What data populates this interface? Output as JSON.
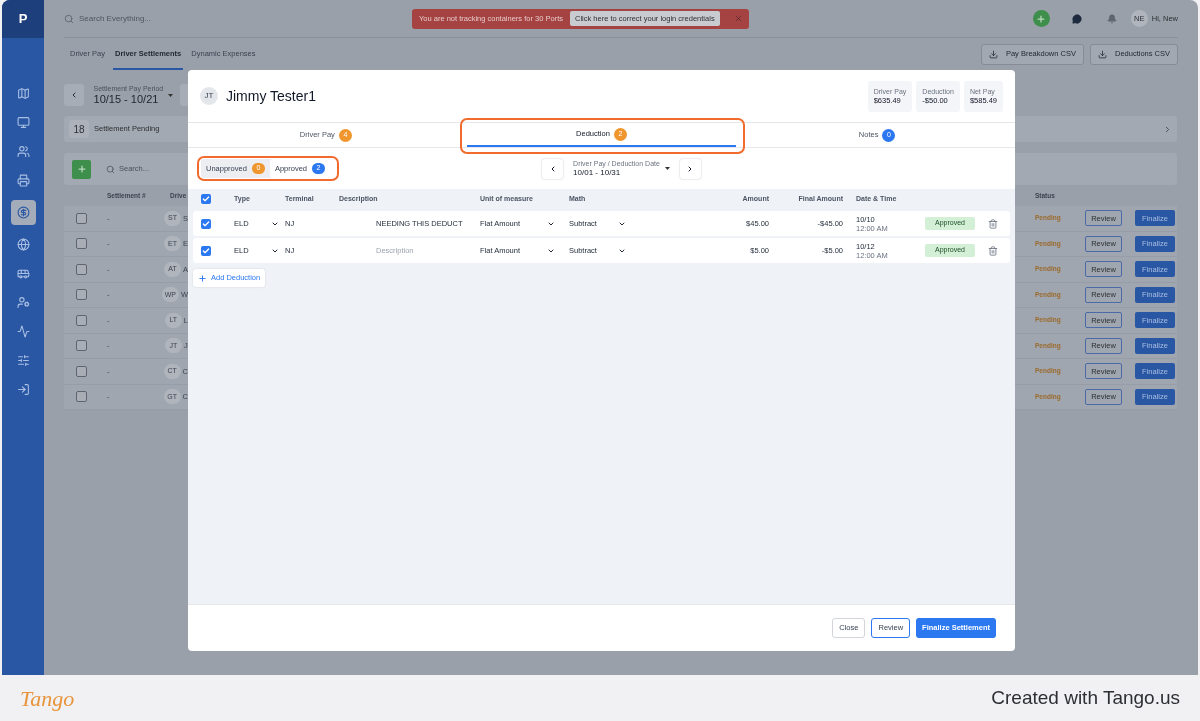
{
  "logo": "P",
  "sidebar": {
    "items": [
      {
        "selected": false
      },
      {
        "selected": false
      },
      {
        "selected": false
      },
      {
        "selected": false
      },
      {
        "selected": true
      },
      {
        "selected": false
      },
      {
        "selected": false
      },
      {
        "selected": false
      },
      {
        "selected": false
      },
      {
        "selected": false
      },
      {
        "selected": false
      }
    ]
  },
  "topbar": {
    "search_placeholder": "Search Everything...",
    "banner": {
      "message": "You are not tracking containers for 30 Ports",
      "action": "Click here to correct your login credentials"
    },
    "user_initials": "NE",
    "greeting": "Hi, New"
  },
  "page_tabs": [
    {
      "label": "Driver Pay",
      "selected": false
    },
    {
      "label": "Driver Settlements",
      "selected": true
    },
    {
      "label": "Dynamic Expenses",
      "selected": false
    }
  ],
  "export_buttons": [
    "Pay Breakdown CSV",
    "Deductions CSV"
  ],
  "period": {
    "label": "Settlement Pay Period",
    "value": "10/15 - 10/21"
  },
  "pending": {
    "count": "18",
    "label": "Settlement Pending"
  },
  "list_search_placeholder": "Search...",
  "background_table": {
    "columns": [
      "Settlement #",
      "Drive"
    ],
    "status_column": "Status",
    "rows": [
      {
        "checked": false,
        "settlement": "-",
        "initials": "ST",
        "name": "S",
        "status": "Pending",
        "review": "Review",
        "finalize": "Finalize"
      },
      {
        "checked": false,
        "settlement": "-",
        "initials": "ET",
        "name": "E",
        "status": "Pending",
        "review": "Review",
        "finalize": "Finalize"
      },
      {
        "checked": false,
        "settlement": "-",
        "initials": "AT",
        "name": "A",
        "status": "Pending",
        "review": "Review",
        "finalize": "Finalize"
      },
      {
        "checked": false,
        "settlement": "-",
        "initials": "WP",
        "name": "W",
        "status": "Pending",
        "review": "Review",
        "finalize": "Finalize"
      },
      {
        "checked": false,
        "settlement": "-",
        "initials": "LT",
        "name": "L",
        "status": "Pending",
        "review": "Review",
        "finalize": "Finalize"
      },
      {
        "checked": false,
        "settlement": "-",
        "initials": "JT",
        "name": "J",
        "status": "Pending",
        "review": "Review",
        "finalize": "Finalize"
      },
      {
        "checked": false,
        "settlement": "-",
        "initials": "CT",
        "name": "C",
        "status": "Pending",
        "review": "Review",
        "finalize": "Finalize"
      },
      {
        "checked": false,
        "settlement": "-",
        "initials": "GT",
        "name": "C",
        "status": "Pending",
        "review": "Review",
        "finalize": "Finalize"
      }
    ]
  },
  "modal": {
    "initials": "JT",
    "driver": "Jimmy Tester1",
    "stats": [
      {
        "label": "Driver Pay",
        "value": "$635.49"
      },
      {
        "label": "Deduction",
        "value": "-$50.00"
      },
      {
        "label": "Net Pay",
        "value": "$585.49"
      }
    ],
    "tabs": [
      {
        "label": "Driver Pay",
        "count": "4",
        "color": "#f0962e",
        "selected": false,
        "highlighted": false
      },
      {
        "label": "Deduction",
        "count": "2",
        "color": "#f0962e",
        "selected": true,
        "highlighted": true
      },
      {
        "label": "Notes",
        "count": "0",
        "color": "#2b78f0",
        "selected": false,
        "highlighted": false
      }
    ],
    "filters": {
      "highlighted": true,
      "items": [
        {
          "label": "Unapproved",
          "count": "0",
          "color": "#f0962e",
          "selected": false
        },
        {
          "label": "Approved",
          "count": "2",
          "color": "#2b78f0",
          "selected": true
        }
      ]
    },
    "date_range": {
      "label": "Driver Pay / Deduction Date",
      "value": "10/01 - 10/31"
    },
    "table": {
      "all_checked": true,
      "columns": [
        "Type",
        "Terminal",
        "Description",
        "Unit of measure",
        "Math",
        "Amount",
        "Final Amount",
        "Date & Time"
      ],
      "rows": [
        {
          "checked": true,
          "type": "ELD",
          "terminal": "NJ",
          "description": {
            "value": "NEEDING THIS DEDUCT"
          },
          "unit": "Flat Amount",
          "math": "Subtract",
          "amount": "$45.00",
          "final_amount": "-$45.00",
          "date": "10/10",
          "time": "12:00 AM",
          "status": "Approved"
        },
        {
          "checked": true,
          "type": "ELD",
          "terminal": "NJ",
          "description": {
            "placeholder": "Description"
          },
          "unit": "Flat Amount",
          "math": "Subtract",
          "amount": "$5.00",
          "final_amount": "-$5.00",
          "date": "10/12",
          "time": "12:00 AM",
          "status": "Approved"
        }
      ]
    },
    "add_button": "Add Deduction",
    "footer_buttons": [
      {
        "label": "Close",
        "kind": "plain"
      },
      {
        "label": "Review",
        "kind": "outline"
      },
      {
        "label": "Finalize Settlement",
        "kind": "primary"
      }
    ]
  },
  "tango": {
    "logo": "Tango",
    "credit": "Created with Tango.us"
  }
}
